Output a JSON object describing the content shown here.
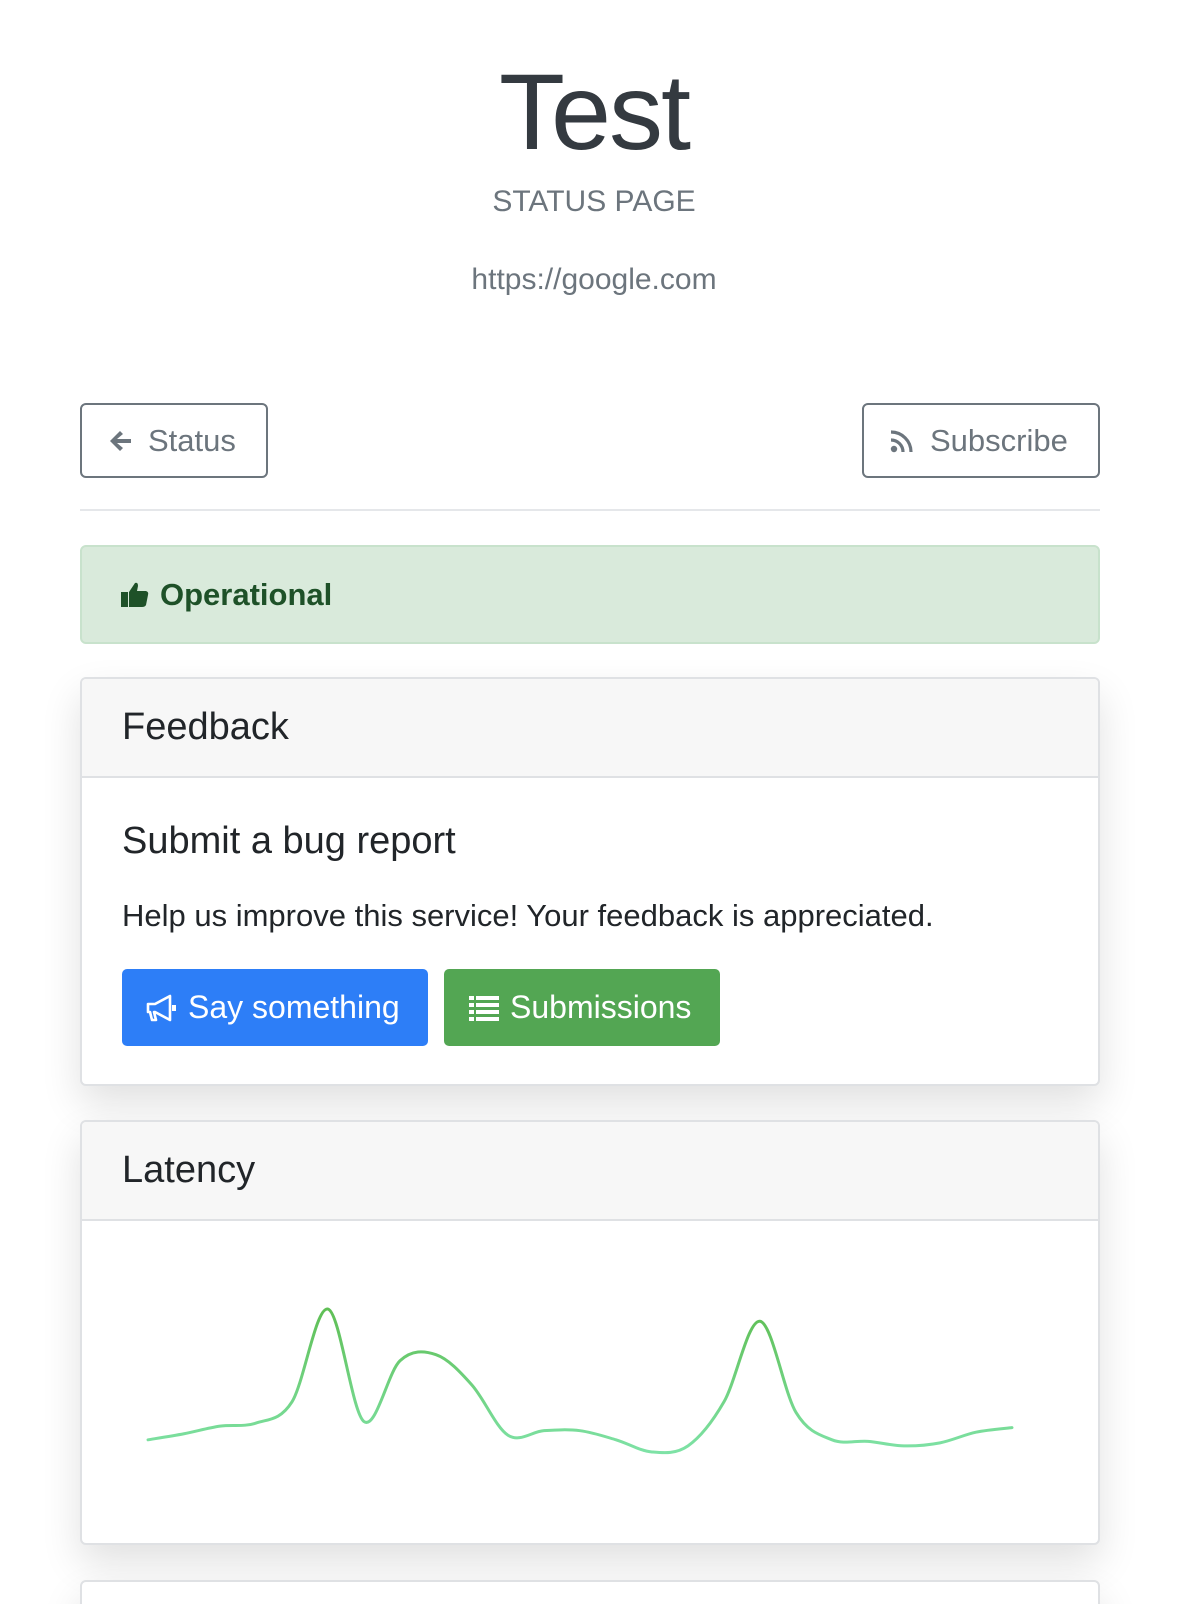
{
  "header": {
    "title": "Test",
    "subtitle": "STATUS PAGE",
    "url": "https://google.com"
  },
  "nav": {
    "status_label": "Status",
    "subscribe_label": "Subscribe"
  },
  "status": {
    "label": "Operational",
    "color": "#1e5128",
    "background": "#d9eadb",
    "icon": "thumbs-up-icon"
  },
  "feedback": {
    "card_title": "Feedback",
    "heading": "Submit a bug report",
    "text": "Help us improve this service! Your feedback is appreciated.",
    "say_label": "Say something",
    "say_icon": "bullhorn-icon",
    "say_color": "#2d7ef7",
    "submissions_label": "Submissions",
    "submissions_icon": "list-icon",
    "submissions_color": "#53a653"
  },
  "latency": {
    "card_title": "Latency",
    "chart_data": {
      "type": "line",
      "x": [
        0,
        1,
        2,
        3,
        4,
        5,
        6,
        7,
        8,
        9,
        10,
        11,
        12,
        13,
        14,
        15,
        16,
        17,
        18,
        19,
        20,
        21,
        22,
        23,
        24
      ],
      "series": [
        {
          "values": [
            10,
            14,
            19,
            21,
            35,
            96,
            22,
            62,
            66,
            46,
            13,
            16,
            16,
            10,
            2,
            6,
            35,
            88,
            28,
            10,
            9,
            6,
            8,
            15,
            18
          ]
        }
      ],
      "ylim": [
        0,
        100
      ],
      "grid": false,
      "line_colors": [
        "#5fbf55",
        "#7ee2a6"
      ]
    }
  }
}
